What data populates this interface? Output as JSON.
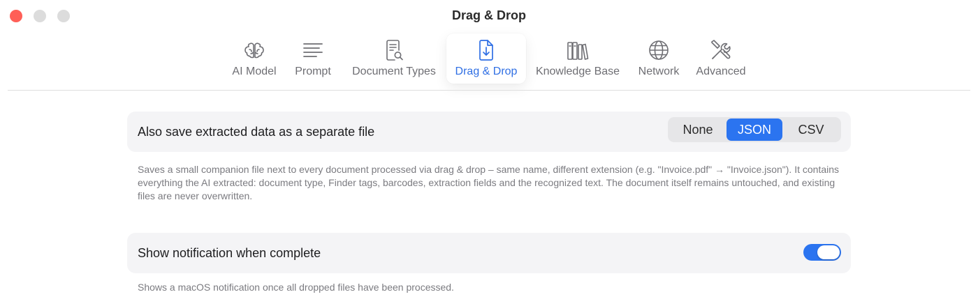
{
  "window": {
    "title": "Drag & Drop"
  },
  "toolbar": {
    "tabs": [
      {
        "label": "AI Model",
        "icon": "brain-icon"
      },
      {
        "label": "Prompt",
        "icon": "text-lines-icon"
      },
      {
        "label": "Document Types",
        "icon": "document-search-icon"
      },
      {
        "label": "Drag & Drop",
        "icon": "document-download-icon",
        "active": true
      },
      {
        "label": "Knowledge Base",
        "icon": "books-icon"
      },
      {
        "label": "Network",
        "icon": "globe-icon"
      },
      {
        "label": "Advanced",
        "icon": "tools-icon"
      }
    ]
  },
  "settings": {
    "save_extracted": {
      "label": "Also save extracted data as a separate file",
      "options": [
        "None",
        "JSON",
        "CSV"
      ],
      "selected": "JSON",
      "description": "Saves a small companion file next to every document processed via drag & drop – same name, different extension (e.g. \"Invoice.pdf\" → \"Invoice.json\"). It contains everything the AI extracted: document type, Finder tags, barcodes, extraction fields and the recognized text. The document itself remains untouched, and existing files are never overwritten."
    },
    "notification": {
      "label": "Show notification when complete",
      "enabled": true,
      "description": "Shows a macOS notification once all dropped files have been processed."
    }
  },
  "colors": {
    "accent": "#2b74f0",
    "close_button": "#ff5f57",
    "row_background": "#f4f4f6"
  }
}
